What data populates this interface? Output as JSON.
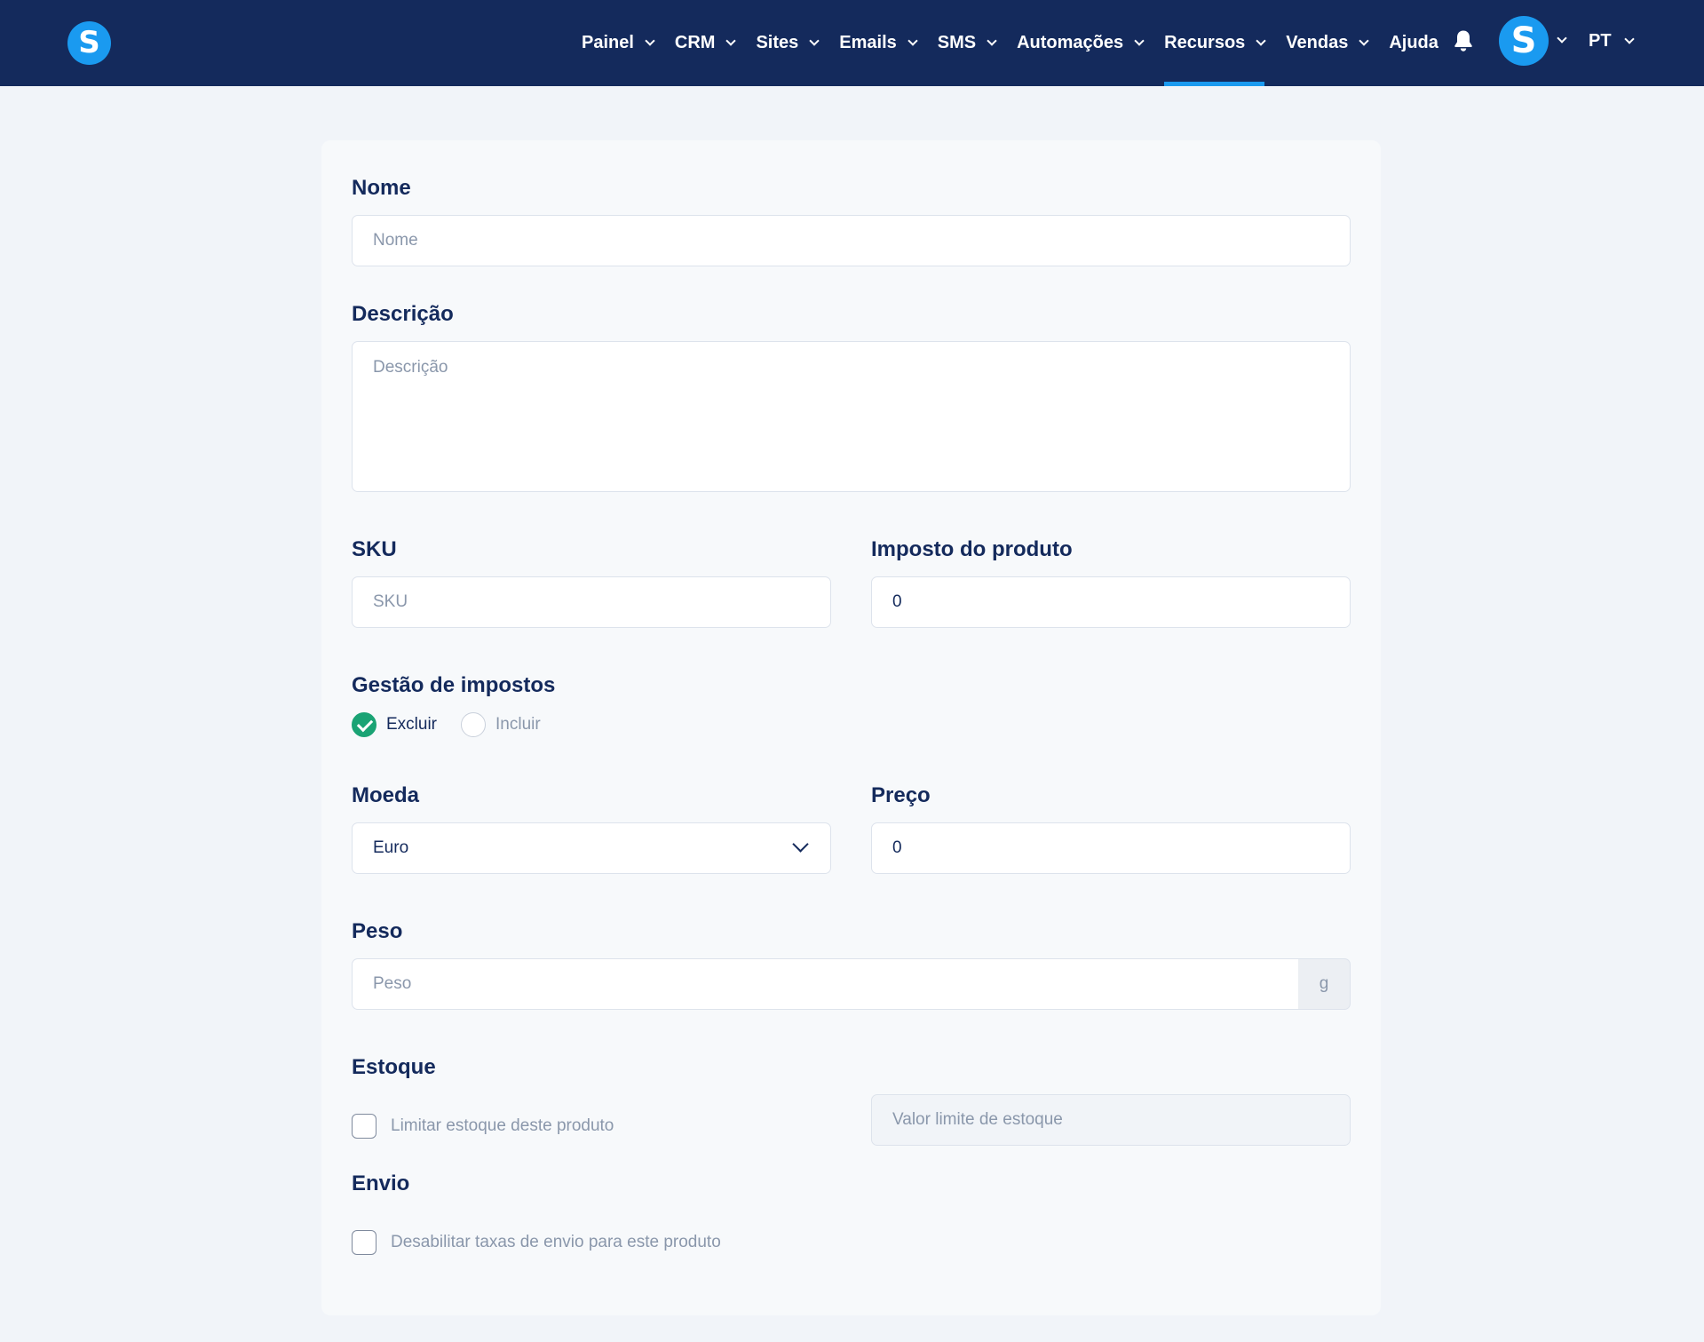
{
  "nav": {
    "logo_letter": "S",
    "items": [
      {
        "label": "Painel",
        "dropdown": true
      },
      {
        "label": "CRM",
        "dropdown": true
      },
      {
        "label": "Sites",
        "dropdown": true
      },
      {
        "label": "Emails",
        "dropdown": true
      },
      {
        "label": "SMS",
        "dropdown": true
      },
      {
        "label": "Automações",
        "dropdown": true
      },
      {
        "label": "Recursos",
        "dropdown": true,
        "active": true
      },
      {
        "label": "Vendas",
        "dropdown": true
      },
      {
        "label": "Ajuda",
        "dropdown": false
      }
    ],
    "avatar_letter": "S",
    "language": "PT",
    "icons": {
      "bell": "bell-icon"
    },
    "colors": {
      "bar": "#142a5c",
      "accent": "#1a9af0"
    }
  },
  "form": {
    "name": {
      "label": "Nome",
      "placeholder": "Nome",
      "value": ""
    },
    "description": {
      "label": "Descrição",
      "placeholder": "Descrição",
      "value": ""
    },
    "sku": {
      "label": "SKU",
      "placeholder": "SKU",
      "value": ""
    },
    "tax": {
      "label": "Imposto do produto",
      "value": "0"
    },
    "tax_management": {
      "label": "Gestão de impostos",
      "options": [
        {
          "label": "Excluir",
          "checked": true
        },
        {
          "label": "Incluir",
          "checked": false
        }
      ],
      "checked_color": "#1aa374"
    },
    "currency": {
      "label": "Moeda",
      "selected": "Euro"
    },
    "price": {
      "label": "Preço",
      "value": "0"
    },
    "weight": {
      "label": "Peso",
      "placeholder": "Peso",
      "unit": "g"
    },
    "stock": {
      "label": "Estoque",
      "checkbox_label": "Limitar estoque deste produto",
      "checked": false,
      "limit_placeholder": "Valor limite de estoque"
    },
    "shipping": {
      "label": "Envio",
      "checkbox_label": "Desabilitar taxas de envio para este produto",
      "checked": false
    }
  }
}
